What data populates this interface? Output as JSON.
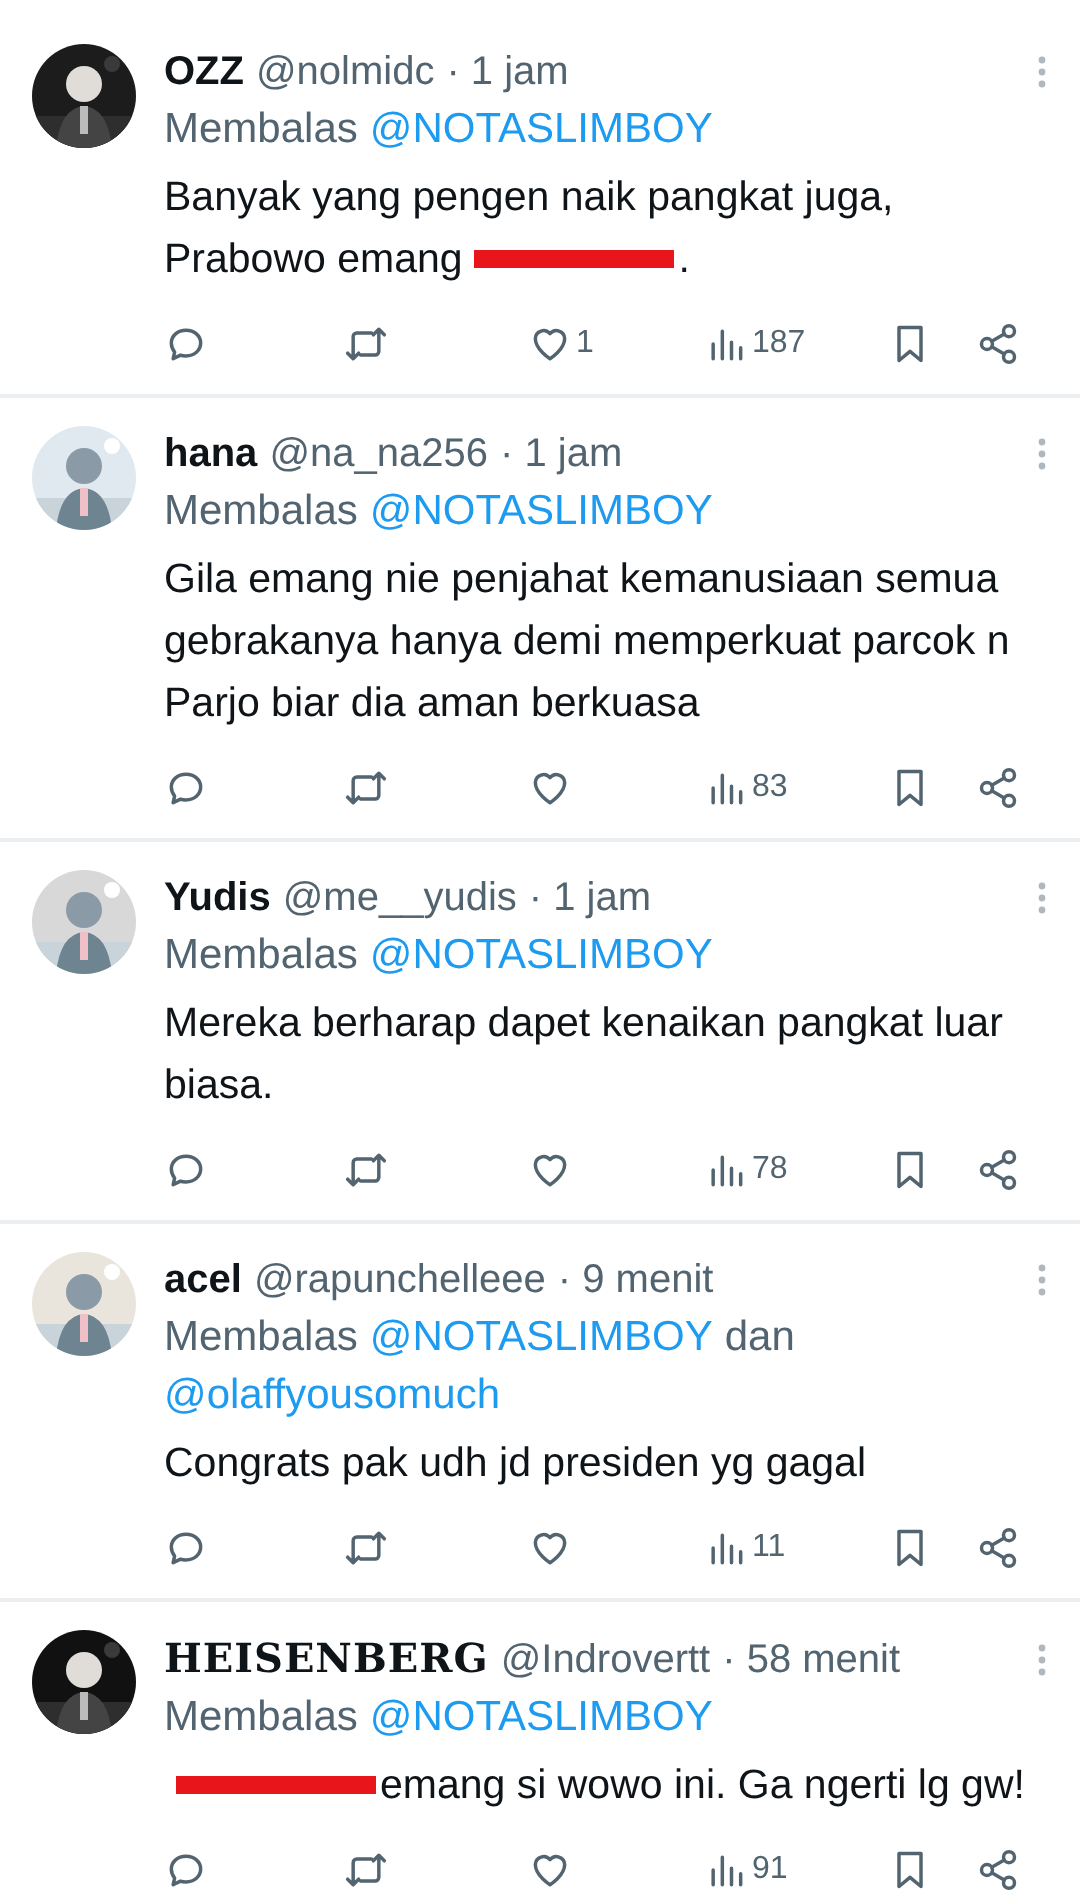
{
  "replies": [
    {
      "name": "OZZ",
      "decorative_name": false,
      "handle": "@nolmidc",
      "time": "· 1 jam",
      "avatar": {
        "kind": "picture",
        "color": "#1c1c1c"
      },
      "replying_label": "Membalas",
      "replying_to": [
        "@NOTASLIMBOY"
      ],
      "body": [
        [
          {
            "kind": "text",
            "text": "Banyak yang pengen naik pangkat juga,"
          }
        ],
        [
          {
            "kind": "text",
            "text": "Prabowo emang"
          },
          {
            "kind": "redaction"
          },
          {
            "kind": "text",
            "text": "."
          }
        ]
      ],
      "likes": "1",
      "views": "187"
    },
    {
      "name": "hana",
      "decorative_name": false,
      "handle": "@na_na256",
      "time": "· 1 jam",
      "avatar": {
        "kind": "picture",
        "color": "#dfe9ef"
      },
      "replying_label": "Membalas",
      "replying_to": [
        "@NOTASLIMBOY"
      ],
      "body": [
        [
          {
            "kind": "text",
            "text": "Gila emang nie penjahat kemanusiaan semua gebrakanya hanya demi memperkuat parcok n Parjo biar dia aman berkuasa"
          }
        ]
      ],
      "views": "83"
    },
    {
      "name": "Yudis",
      "decorative_name": false,
      "handle": "@me__yudis",
      "time": "· 1 jam",
      "avatar": {
        "kind": "picture",
        "color": "#d8d8d8"
      },
      "replying_label": "Membalas",
      "replying_to": [
        "@NOTASLIMBOY"
      ],
      "body": [
        [
          {
            "kind": "text",
            "text": "Mereka berharap dapet kenaikan pangkat luar biasa."
          }
        ]
      ],
      "views": "78"
    },
    {
      "name": "acel",
      "decorative_name": false,
      "handle": "@rapunchelleee",
      "time": "· 9 menit",
      "avatar": {
        "kind": "picture",
        "color": "#e9e4dc"
      },
      "replying_label": "Membalas",
      "replying_to": [
        "@NOTASLIMBOY",
        "dan",
        "@olaffyousomuch"
      ],
      "body": [
        [
          {
            "kind": "text",
            "text": "Congrats pak udh jd presiden yg gagal"
          }
        ]
      ],
      "views": "11"
    },
    {
      "name": "HEISENBERG",
      "decorative_name": true,
      "handle": "@Indrovertt",
      "time": "· 58 menit",
      "avatar": {
        "kind": "picture",
        "color": "#111111"
      },
      "replying_label": "Membalas",
      "replying_to": [
        "@NOTASLIMBOY"
      ],
      "body": [
        [
          {
            "kind": "redaction"
          },
          {
            "kind": "text",
            "text": "emang si wowo ini. Ga ngerti lg gw!"
          }
        ]
      ],
      "views": "91"
    }
  ]
}
